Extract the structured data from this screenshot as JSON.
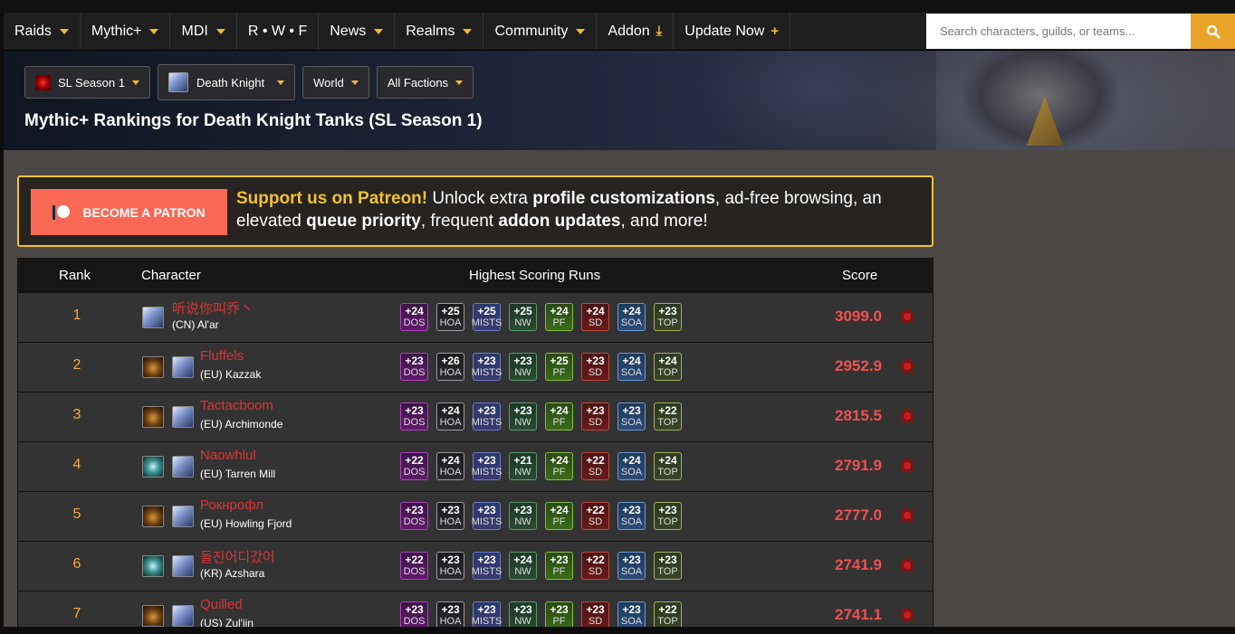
{
  "nav": {
    "items": [
      {
        "label": "Raids",
        "caret": true
      },
      {
        "label": "Mythic+",
        "caret": true
      },
      {
        "label": "MDI",
        "caret": true
      },
      {
        "label": "R • W • F",
        "caret": false
      },
      {
        "label": "News",
        "caret": true
      },
      {
        "label": "Realms",
        "caret": true
      },
      {
        "label": "Community",
        "caret": true
      },
      {
        "label": "Addon",
        "glyph": "download-icon"
      },
      {
        "label": "Update Now",
        "glyph": "plus-icon"
      }
    ],
    "search_placeholder": "Search characters, guilds, or teams..."
  },
  "filters": {
    "season": "SL Season 1",
    "class": "Death Knight",
    "region": "World",
    "faction": "All Factions"
  },
  "page_title": "Mythic+ Rankings for Death Knight Tanks (SL Season 1)",
  "patreon": {
    "button": "BECOME A PATRON",
    "lead": "Support us on Patreon!",
    "t1": " Unlock extra ",
    "b1": "profile customizations",
    "t2": ", ad-free browsing, an elevated ",
    "b2": "queue priority",
    "t3": ", frequent ",
    "b3": "addon updates",
    "t4": ", and more!"
  },
  "table": {
    "headers": {
      "rank": "Rank",
      "character": "Character",
      "runs": "Highest Scoring Runs",
      "score": "Score"
    },
    "dungeons": [
      "DOS",
      "HOA",
      "MISTS",
      "NW",
      "PF",
      "SD",
      "SOA",
      "TOP"
    ],
    "rows": [
      {
        "rank": "1",
        "name": "听说你叫乔丶",
        "realm": "(CN) Al'ar",
        "covenant": "",
        "runs": [
          "+24",
          "+25",
          "+25",
          "+25",
          "+24",
          "+24",
          "+24",
          "+23"
        ],
        "score": "3099.0",
        "faction": "horde"
      },
      {
        "rank": "2",
        "name": "Fluffels",
        "realm": "(EU) Kazzak",
        "covenant": "venthyr",
        "runs": [
          "+23",
          "+26",
          "+23",
          "+23",
          "+25",
          "+23",
          "+24",
          "+24"
        ],
        "score": "2952.9",
        "faction": "horde"
      },
      {
        "rank": "3",
        "name": "Tactacboom",
        "realm": "(EU) Archimonde",
        "covenant": "venthyr",
        "runs": [
          "+23",
          "+24",
          "+23",
          "+23",
          "+24",
          "+23",
          "+23",
          "+22"
        ],
        "score": "2815.5",
        "faction": "horde"
      },
      {
        "rank": "4",
        "name": "Naowhlul",
        "realm": "(EU) Tarren Mill",
        "covenant": "kyrian",
        "runs": [
          "+22",
          "+24",
          "+23",
          "+21",
          "+24",
          "+22",
          "+24",
          "+24"
        ],
        "score": "2791.9",
        "faction": "horde"
      },
      {
        "rank": "5",
        "name": "Рокнрофл",
        "realm": "(EU) Howling Fjord",
        "covenant": "venthyr",
        "runs": [
          "+23",
          "+23",
          "+23",
          "+23",
          "+24",
          "+22",
          "+23",
          "+23"
        ],
        "score": "2777.0",
        "faction": "horde"
      },
      {
        "rank": "6",
        "name": "돌진어디갔어",
        "realm": "(KR) Azshara",
        "covenant": "kyrian",
        "runs": [
          "+22",
          "+23",
          "+23",
          "+24",
          "+23",
          "+22",
          "+23",
          "+23"
        ],
        "score": "2741.9",
        "faction": "horde"
      },
      {
        "rank": "7",
        "name": "Quilled",
        "realm": "(US) Zul'jin",
        "covenant": "venthyr",
        "runs": [
          "+23",
          "+23",
          "+23",
          "+23",
          "+23",
          "+23",
          "+23",
          "+22"
        ],
        "score": "2741.1",
        "faction": "horde"
      }
    ]
  },
  "colors": {
    "accent": "#f5b82e",
    "patreon": "#f96854",
    "name": "#d93434",
    "rank": "#f2a940",
    "score": "#f05050"
  }
}
